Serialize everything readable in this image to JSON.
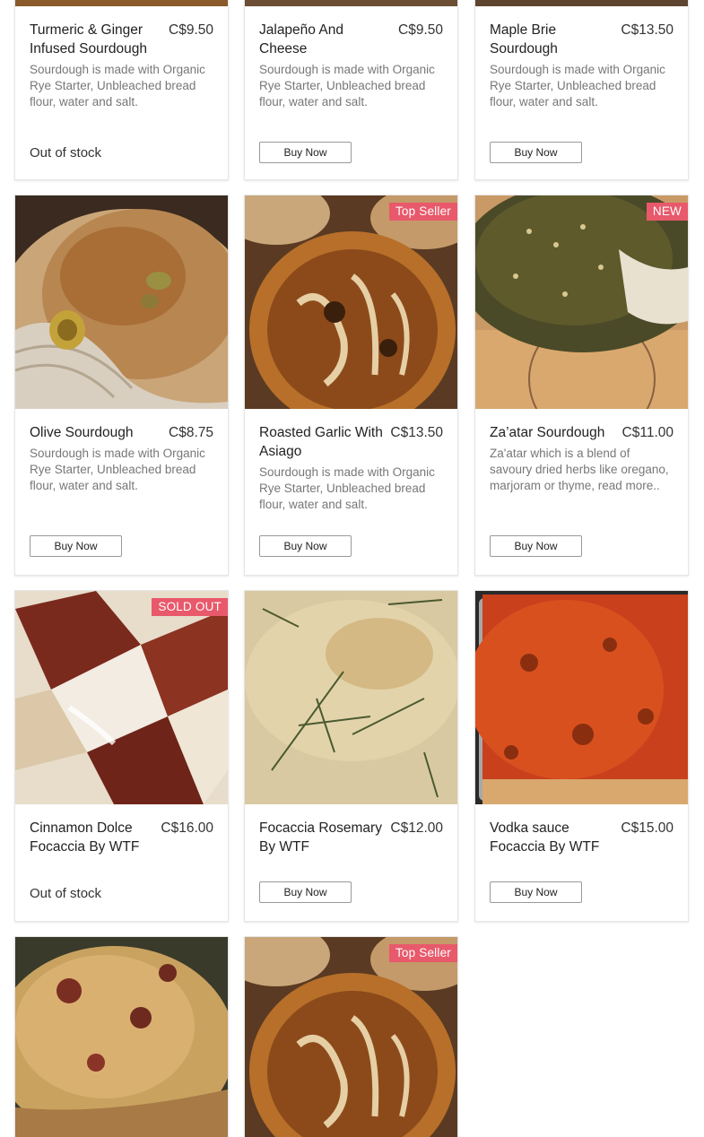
{
  "colors": {
    "ribbon": "#e8596b",
    "card_border": "#e6e6e6",
    "text": "#222222",
    "muted": "#777777"
  },
  "products": [
    {
      "name": "Turmeric & Ginger Infused Sourdough",
      "price": "C$9.50",
      "description": "Sourdough is made with Organic Rye Starter, Unbleached bread flour, water and salt.",
      "status": "Out of stock"
    },
    {
      "name": "Jalapeño And Cheese",
      "price": "C$9.50",
      "description": "Sourdough is made with Organic Rye Starter, Unbleached bread flour, water and salt.",
      "button": "Buy Now"
    },
    {
      "name": "Maple Brie Sourdough",
      "price": "C$13.50",
      "description": "Sourdough is made with Organic Rye Starter, Unbleached bread flour, water and salt.",
      "button": "Buy Now"
    },
    {
      "name": "Olive Sourdough",
      "price": "C$8.75",
      "description": "Sourdough is made with Organic Rye Starter, Unbleached bread flour, water and salt.",
      "button": "Buy Now"
    },
    {
      "name": "Roasted Garlic With Asiago",
      "price": "C$13.50",
      "description": "Sourdough is made with Organic Rye Starter, Unbleached bread flour, water and salt.",
      "button": "Buy Now",
      "ribbon": "Top Seller"
    },
    {
      "name": "Za’atar Sourdough",
      "price": "C$11.00",
      "description": "Za'atar which is a blend of savoury dried herbs like oregano, marjoram or thyme, read more..",
      "button": "Buy Now",
      "ribbon": "NEW"
    },
    {
      "name": "Cinnamon Dolce Focaccia By WTF",
      "price": "C$16.00",
      "status": "Out of stock",
      "ribbon": "SOLD OUT"
    },
    {
      "name": "Focaccia Rosemary By WTF",
      "price": "C$12.00",
      "button": "Buy Now"
    },
    {
      "name": "Vodka sauce Focaccia By WTF",
      "price": "C$15.00",
      "button": "Buy Now"
    },
    {},
    {
      "ribbon": "Top Seller"
    }
  ]
}
